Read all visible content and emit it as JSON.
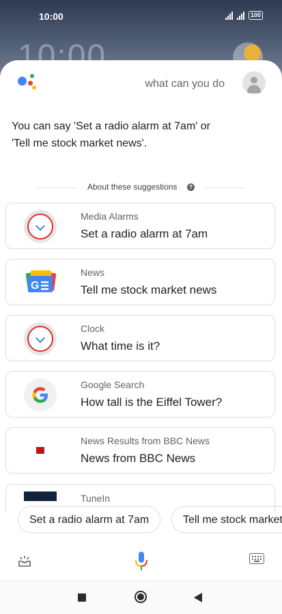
{
  "status_bar": {
    "time": "10:00",
    "battery": "100"
  },
  "wallpaper": {
    "clock_text": "10:00"
  },
  "assistant": {
    "query": "what can you do",
    "answer_line1": "You can say 'Set a radio alarm at 7am' or",
    "answer_line2": "'Tell me stock market news'.",
    "suggestions_header": "About these suggestions"
  },
  "suggestions": [
    {
      "source": "Media Alarms",
      "title": "Set a radio alarm at 7am",
      "icon": "clock-icon"
    },
    {
      "source": "News",
      "title": "Tell me stock market news",
      "icon": "google-news-icon"
    },
    {
      "source": "Clock",
      "title": "What time is it?",
      "icon": "clock-icon"
    },
    {
      "source": "Google Search",
      "title": "How tall is the Eiffel Tower?",
      "icon": "google-g-icon"
    },
    {
      "source": "News Results from BBC News",
      "title": "News from BBC News",
      "icon": "bbc-news-icon"
    },
    {
      "source": "TuneIn",
      "title": "",
      "icon": "tunein-icon"
    }
  ],
  "chips": [
    {
      "label": "Set a radio alarm at 7am"
    },
    {
      "label": "Tell me stock market news"
    }
  ],
  "toolbar": {
    "left_icon": "snapshot-tray-icon",
    "center_icon": "microphone-icon",
    "right_icon": "keyboard-icon"
  },
  "colors": {
    "google_blue": "#4285f4",
    "google_red": "#ea4335",
    "google_yellow": "#fbbc05",
    "google_green": "#34a853",
    "clock_red": "#d93025",
    "bbc_red": "#bb1919"
  }
}
